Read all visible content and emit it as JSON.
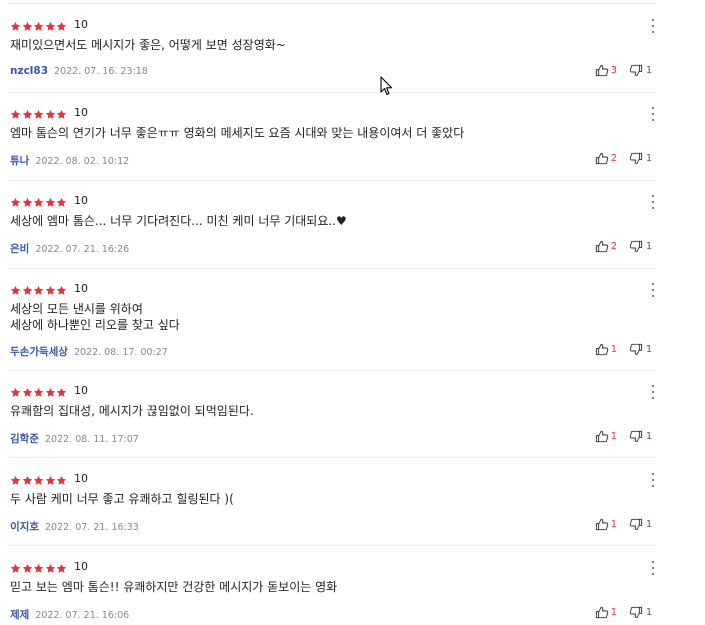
{
  "reviews": [
    {
      "rating": 5,
      "score": "10",
      "text": "재미있으면서도 메시지가 좋은, 어떻게 보면 성장영화~",
      "nickname": "nzcl83",
      "date": "2022. 07. 16. 23:18",
      "likes": "3",
      "dislikes": "1"
    },
    {
      "rating": 5,
      "score": "10",
      "text": "엠마 톰슨의 연기가 너무 좋은ㅠㅠ 영화의 메세지도 요즘 시대와 맞는 내용이여서 더 좋았다",
      "nickname": "튜나",
      "date": "2022. 08. 02. 10:12",
      "likes": "2",
      "dislikes": "1"
    },
    {
      "rating": 5,
      "score": "10",
      "text": "세상에 엠마 톰슨... 너무 기다려진다... 미친 케미 너무 기대되요..♥",
      "nickname": "은비",
      "date": "2022. 07. 21. 16:26",
      "likes": "2",
      "dislikes": "1"
    },
    {
      "rating": 5,
      "score": "10",
      "text": "세상의 모든 낸시를 위하여\n세상에 하나뿐인 리오를 찾고 싶다",
      "nickname": "두손가득세상",
      "date": "2022. 08. 17. 00:27",
      "likes": "1",
      "dislikes": "1"
    },
    {
      "rating": 5,
      "score": "10",
      "text": "유쾌함의 집대성, 메시지가 끊임없이 되먹임된다.",
      "nickname": "김학준",
      "date": "2022. 08. 11. 17:07",
      "likes": "1",
      "dislikes": "1"
    },
    {
      "rating": 5,
      "score": "10",
      "text": "두 사람 케미 너무 좋고 유쾌하고 힐링된다 )(",
      "nickname": "이지호",
      "date": "2022. 07. 21. 16:33",
      "likes": "1",
      "dislikes": "1"
    },
    {
      "rating": 5,
      "score": "10",
      "text": "믿고 보는 엠마 톰슨!! 유쾌하지만 건강한 메시지가 돋보이는 영화",
      "nickname": "제제",
      "date": "2022. 07. 21. 16:06",
      "likes": "1",
      "dislikes": "1"
    }
  ],
  "icons": {
    "star": "star-icon",
    "menu": "more-vertical-icon",
    "like": "thumbs-up-icon",
    "dislike": "thumbs-down-icon",
    "cursor": "mouse-pointer-icon"
  },
  "colors": {
    "star": "#e8333b",
    "nickname": "#3b57a6",
    "like_count": "#e8333b",
    "dislike_count": "#3b57a6"
  }
}
